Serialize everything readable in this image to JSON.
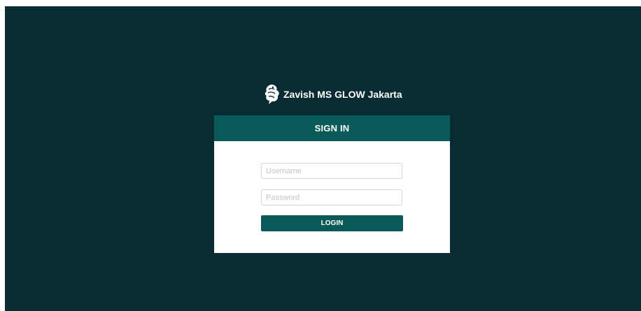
{
  "brand": {
    "name": "Zavish MS GLOW Jakarta",
    "logo_icon": "dragon-logo-icon"
  },
  "login_card": {
    "title": "SIGN IN",
    "username": {
      "value": "",
      "placeholder": "Username"
    },
    "password": {
      "value": "",
      "placeholder": "Password"
    },
    "login_label": "LOGIN"
  },
  "colors": {
    "background": "#082c31",
    "header": "#0a5a5a",
    "button": "#0a5a5a",
    "card": "#ffffff"
  }
}
